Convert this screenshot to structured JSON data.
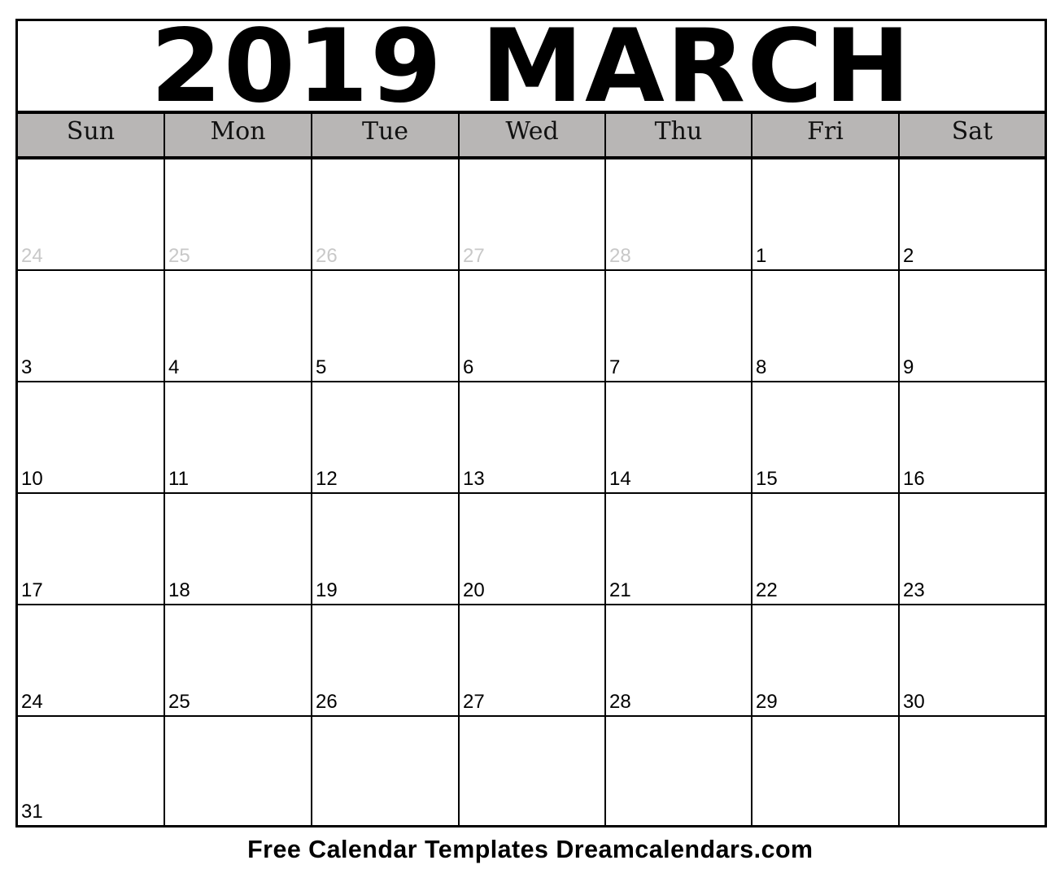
{
  "calendar": {
    "title": "2019 MARCH",
    "weekdays": [
      "Sun",
      "Mon",
      "Tue",
      "Wed",
      "Thu",
      "Fri",
      "Sat"
    ],
    "weeks": [
      [
        {
          "day": "24",
          "muted": true
        },
        {
          "day": "25",
          "muted": true
        },
        {
          "day": "26",
          "muted": true
        },
        {
          "day": "27",
          "muted": true
        },
        {
          "day": "28",
          "muted": true
        },
        {
          "day": "1",
          "muted": false
        },
        {
          "day": "2",
          "muted": false
        }
      ],
      [
        {
          "day": "3",
          "muted": false
        },
        {
          "day": "4",
          "muted": false
        },
        {
          "day": "5",
          "muted": false
        },
        {
          "day": "6",
          "muted": false
        },
        {
          "day": "7",
          "muted": false
        },
        {
          "day": "8",
          "muted": false
        },
        {
          "day": "9",
          "muted": false
        }
      ],
      [
        {
          "day": "10",
          "muted": false
        },
        {
          "day": "11",
          "muted": false
        },
        {
          "day": "12",
          "muted": false
        },
        {
          "day": "13",
          "muted": false
        },
        {
          "day": "14",
          "muted": false
        },
        {
          "day": "15",
          "muted": false
        },
        {
          "day": "16",
          "muted": false
        }
      ],
      [
        {
          "day": "17",
          "muted": false
        },
        {
          "day": "18",
          "muted": false
        },
        {
          "day": "19",
          "muted": false
        },
        {
          "day": "20",
          "muted": false
        },
        {
          "day": "21",
          "muted": false
        },
        {
          "day": "22",
          "muted": false
        },
        {
          "day": "23",
          "muted": false
        }
      ],
      [
        {
          "day": "24",
          "muted": false
        },
        {
          "day": "25",
          "muted": false
        },
        {
          "day": "26",
          "muted": false
        },
        {
          "day": "27",
          "muted": false
        },
        {
          "day": "28",
          "muted": false
        },
        {
          "day": "29",
          "muted": false
        },
        {
          "day": "30",
          "muted": false
        }
      ],
      [
        {
          "day": "31",
          "muted": false
        },
        {
          "day": "",
          "muted": false
        },
        {
          "day": "",
          "muted": false
        },
        {
          "day": "",
          "muted": false
        },
        {
          "day": "",
          "muted": false
        },
        {
          "day": "",
          "muted": false
        },
        {
          "day": "",
          "muted": false
        }
      ]
    ]
  },
  "footer": {
    "text": "Free Calendar Templates Dreamcalendars.com"
  },
  "colors": {
    "header_bg": "#b8b6b5",
    "muted_day": "#c8c8c8",
    "border": "#000000"
  }
}
